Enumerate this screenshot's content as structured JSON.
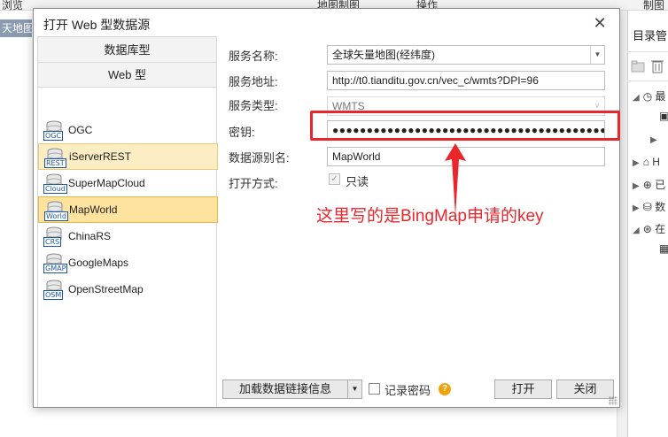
{
  "background": {
    "menu_items": [
      "浏览",
      "地图制图",
      "操作",
      "制图"
    ],
    "map_tab": "天地图",
    "right_panel_title": "目录管",
    "tree_labels": [
      "最",
      "H",
      "已",
      "数",
      "在"
    ]
  },
  "dialog": {
    "title": "打开 Web 型数据源",
    "close_glyph": "✕",
    "left": {
      "header": "数据库型",
      "subheader": "Web 型",
      "sources": [
        {
          "label": "OGC",
          "tag": "OGC"
        },
        {
          "label": "iServerREST",
          "tag": "REST"
        },
        {
          "label": "SuperMapCloud",
          "tag": "Cloud"
        },
        {
          "label": "MapWorld",
          "tag": "World"
        },
        {
          "label": "ChinaRS",
          "tag": "CRS"
        },
        {
          "label": "GoogleMaps",
          "tag": "GMAP"
        },
        {
          "label": "OpenStreetMap",
          "tag": "OSM"
        }
      ],
      "hover_index": 1,
      "selected_index": 3
    },
    "form": {
      "service_name_label": "服务名称:",
      "service_name_value": "全球矢量地图(经纬度)",
      "service_url_label": "服务地址:",
      "service_url_value": "http://t0.tianditu.gov.cn/vec_c/wmts?DPI=96",
      "service_type_label": "服务类型:",
      "service_type_value": "WMTS",
      "key_label": "密钥:",
      "key_value": "●●●●●●●●●●●●●●●●●●●●●●●●●●●●●●●●●●●●●●●●",
      "alias_label": "数据源别名:",
      "alias_value": "MapWorld",
      "open_mode_label": "打开方式:",
      "readonly_label": "只读",
      "readonly_checked": true
    },
    "footer": {
      "load_link_label": "加载数据链接信息",
      "remember_password_label": "记录密码",
      "help_glyph": "?",
      "open_label": "打开",
      "close_label": "关闭"
    }
  },
  "annotation": {
    "text": "这里写的是BingMap申请的key",
    "color": "#e8262b"
  }
}
